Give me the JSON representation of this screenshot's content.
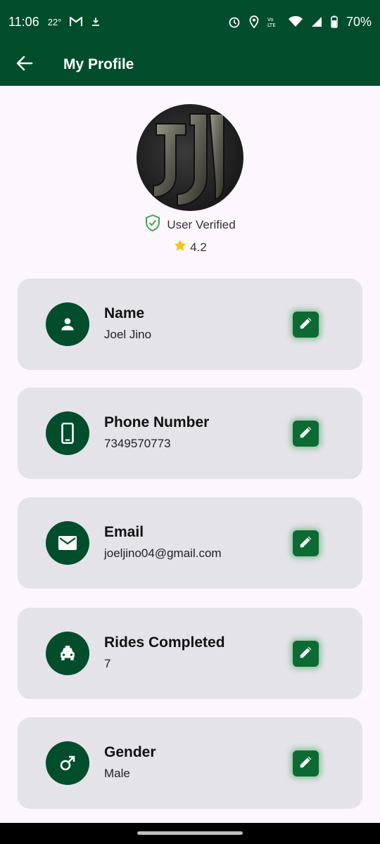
{
  "status_bar": {
    "time": "11:06",
    "temperature": "22°",
    "battery": "70%",
    "icons": [
      "gmail-icon",
      "download-icon",
      "alarm-icon",
      "location-icon",
      "volte-icon",
      "wifi-icon",
      "signal-icon",
      "battery-icon"
    ]
  },
  "app_bar": {
    "title": "My Profile",
    "back_icon": "arrow-back-icon"
  },
  "profile": {
    "verified_label": "User Verified",
    "rating": "4.2"
  },
  "fields": [
    {
      "label": "Name",
      "value": "Joel Jino",
      "icon": "person-icon"
    },
    {
      "label": "Phone Number",
      "value": "7349570773",
      "icon": "phone-icon"
    },
    {
      "label": "Email",
      "value": "joeljino04@gmail.com",
      "icon": "mail-icon"
    },
    {
      "label": "Rides Completed",
      "value": "7",
      "icon": "taxi-icon"
    },
    {
      "label": "Gender",
      "value": "Male",
      "icon": "male-icon"
    }
  ],
  "colors": {
    "primary": "#014d2c",
    "card_bg": "#e3e3e8",
    "edit_button": "#0b6b32",
    "verified": "#3fa54a",
    "star": "#f5c518"
  }
}
